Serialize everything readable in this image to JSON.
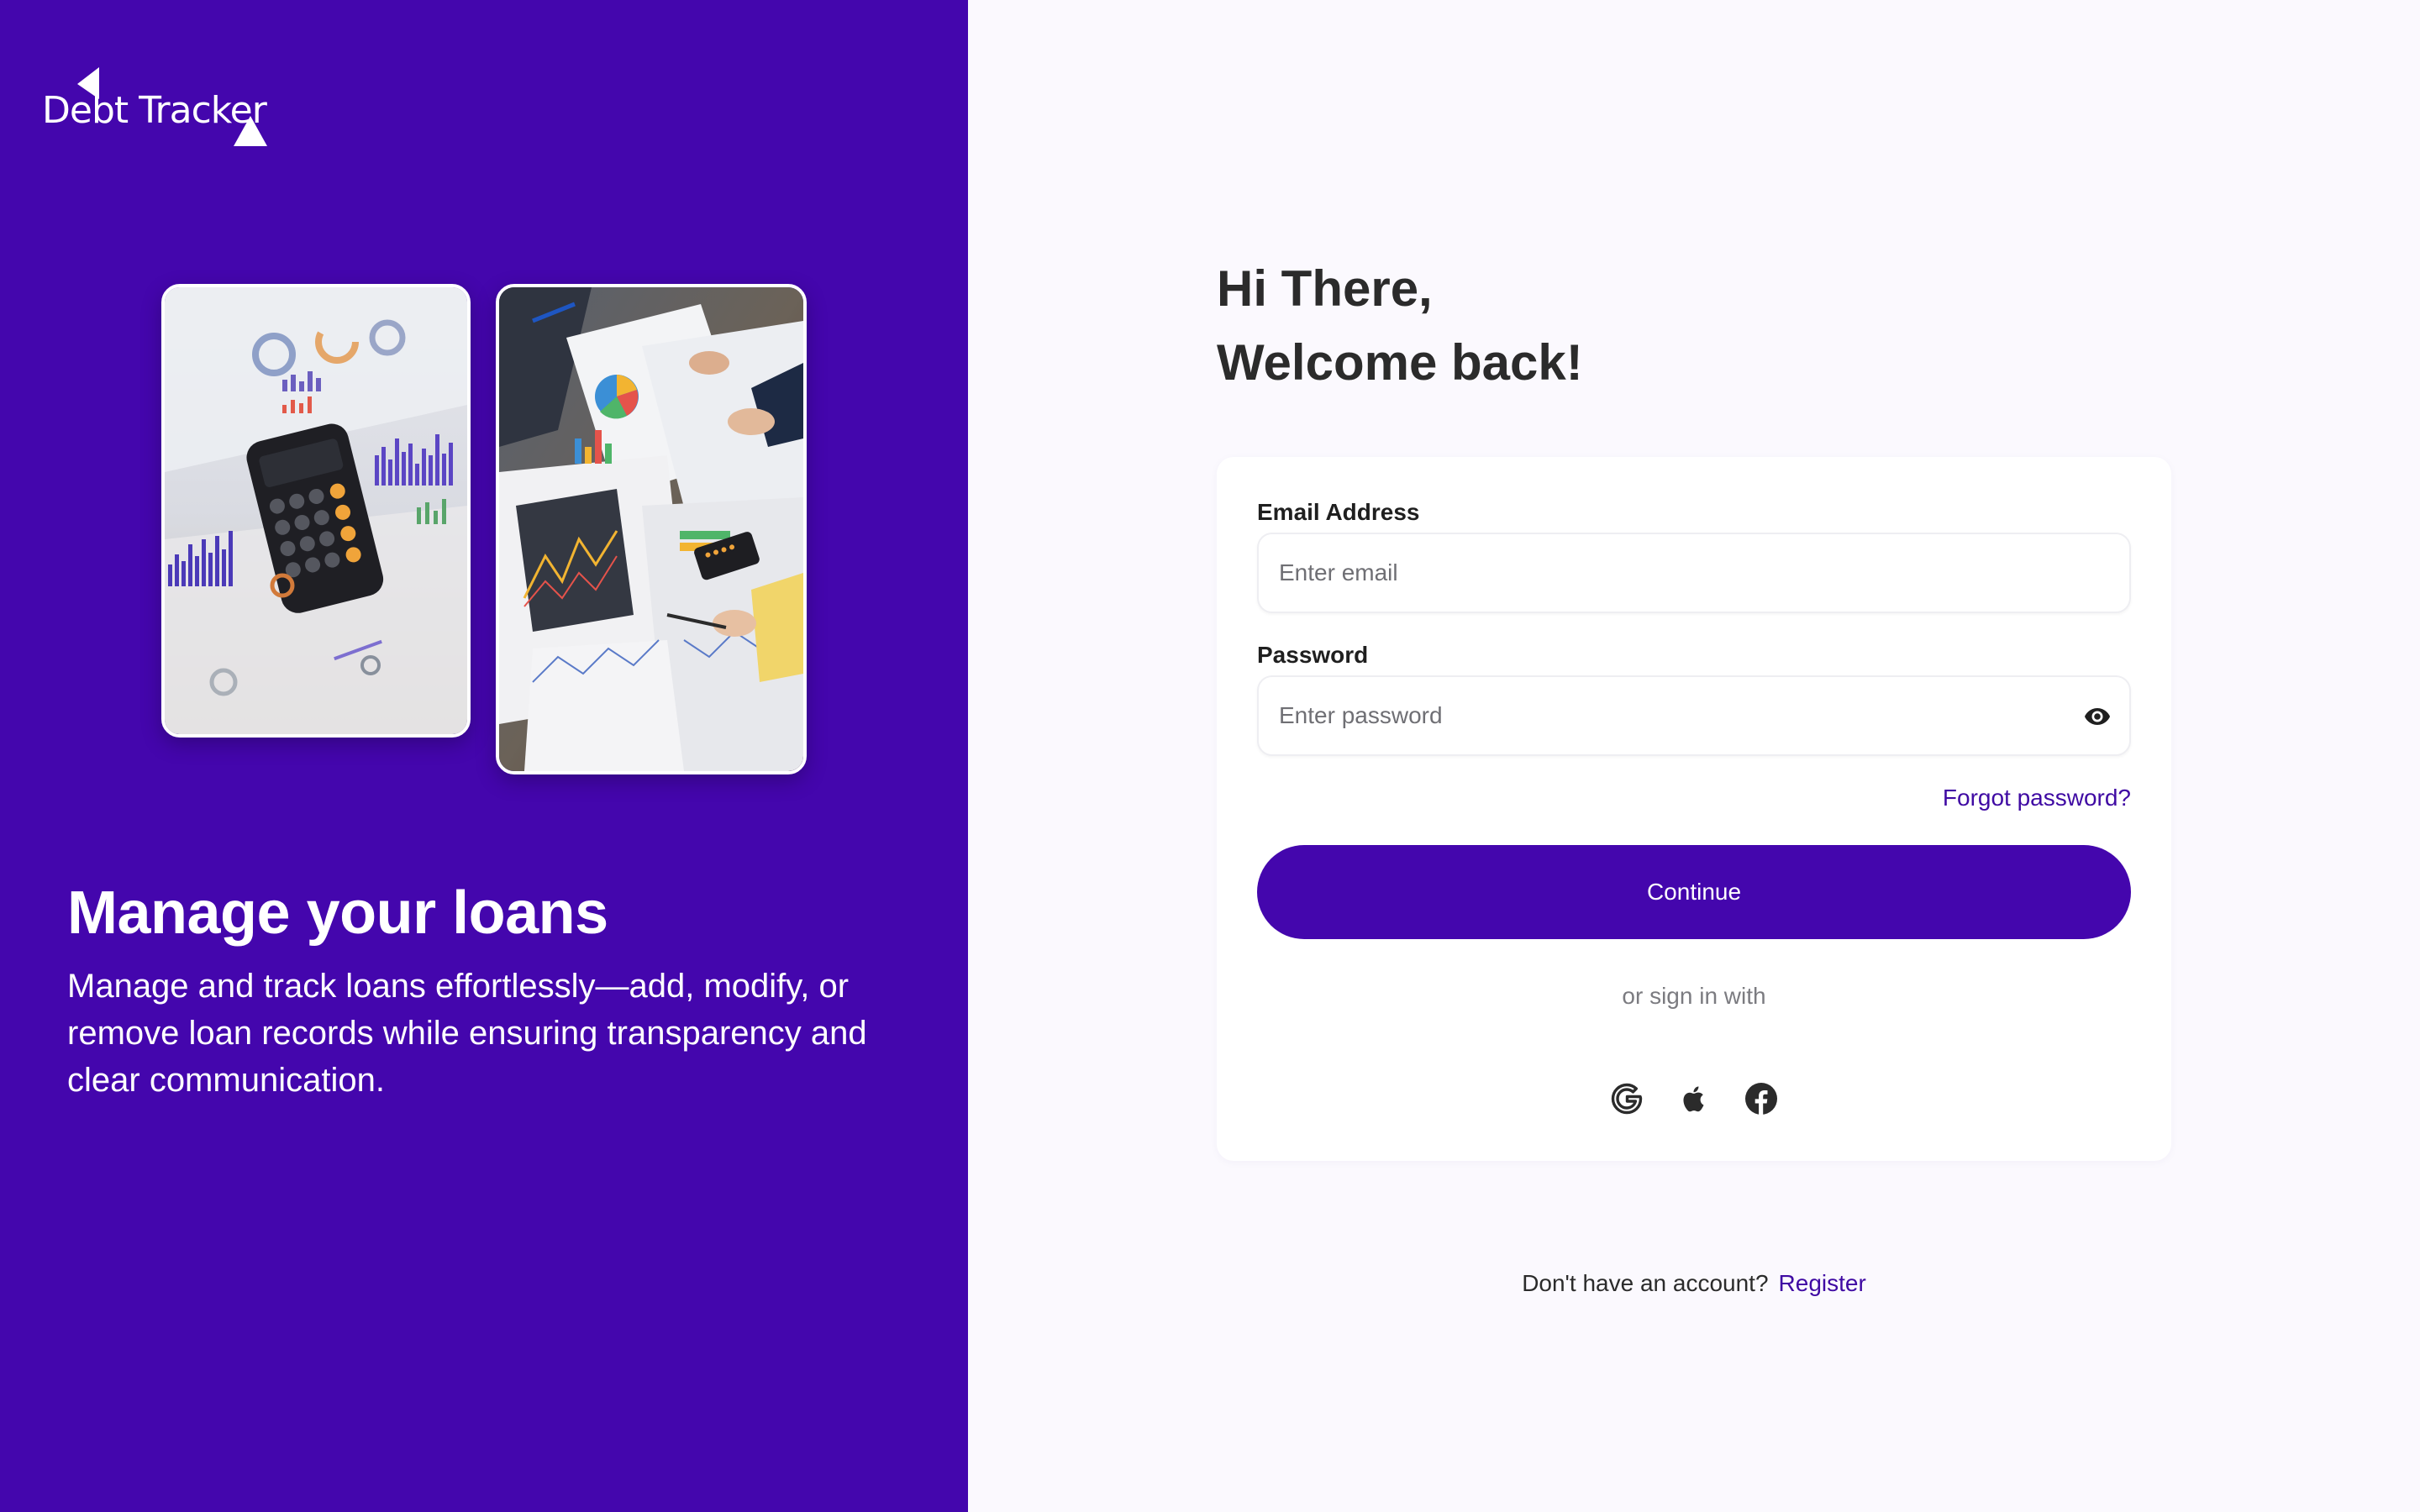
{
  "brand": {
    "logo_text": "Debt Tracker",
    "primary_color": "#4406ad",
    "link_color": "#3f0aa3",
    "background_color": "#fbf9fe"
  },
  "hero": {
    "title": "Manage your loans",
    "description": "Manage and track loans effortlessly—add, modify, or remove loan records while ensuring transparency and clear communication.",
    "images": [
      {
        "name": "calculator-charts-photo"
      },
      {
        "name": "financial-reports-photo"
      }
    ]
  },
  "greeting": {
    "line1": "Hi There,",
    "line2": "Welcome back!"
  },
  "form": {
    "email": {
      "label": "Email Address",
      "placeholder": "Enter email",
      "value": ""
    },
    "password": {
      "label": "Password",
      "placeholder": "Enter password",
      "value": "",
      "toggle_icon": "eye-icon"
    },
    "forgot_password": "Forgot password?",
    "submit_label": "Continue",
    "alt_signin_text": "or sign in with",
    "social_providers": [
      {
        "name": "google",
        "icon": "google-icon"
      },
      {
        "name": "apple",
        "icon": "apple-icon"
      },
      {
        "name": "facebook",
        "icon": "facebook-icon"
      }
    ]
  },
  "footer": {
    "prompt": "Don't have an account?",
    "register_label": "Register"
  }
}
